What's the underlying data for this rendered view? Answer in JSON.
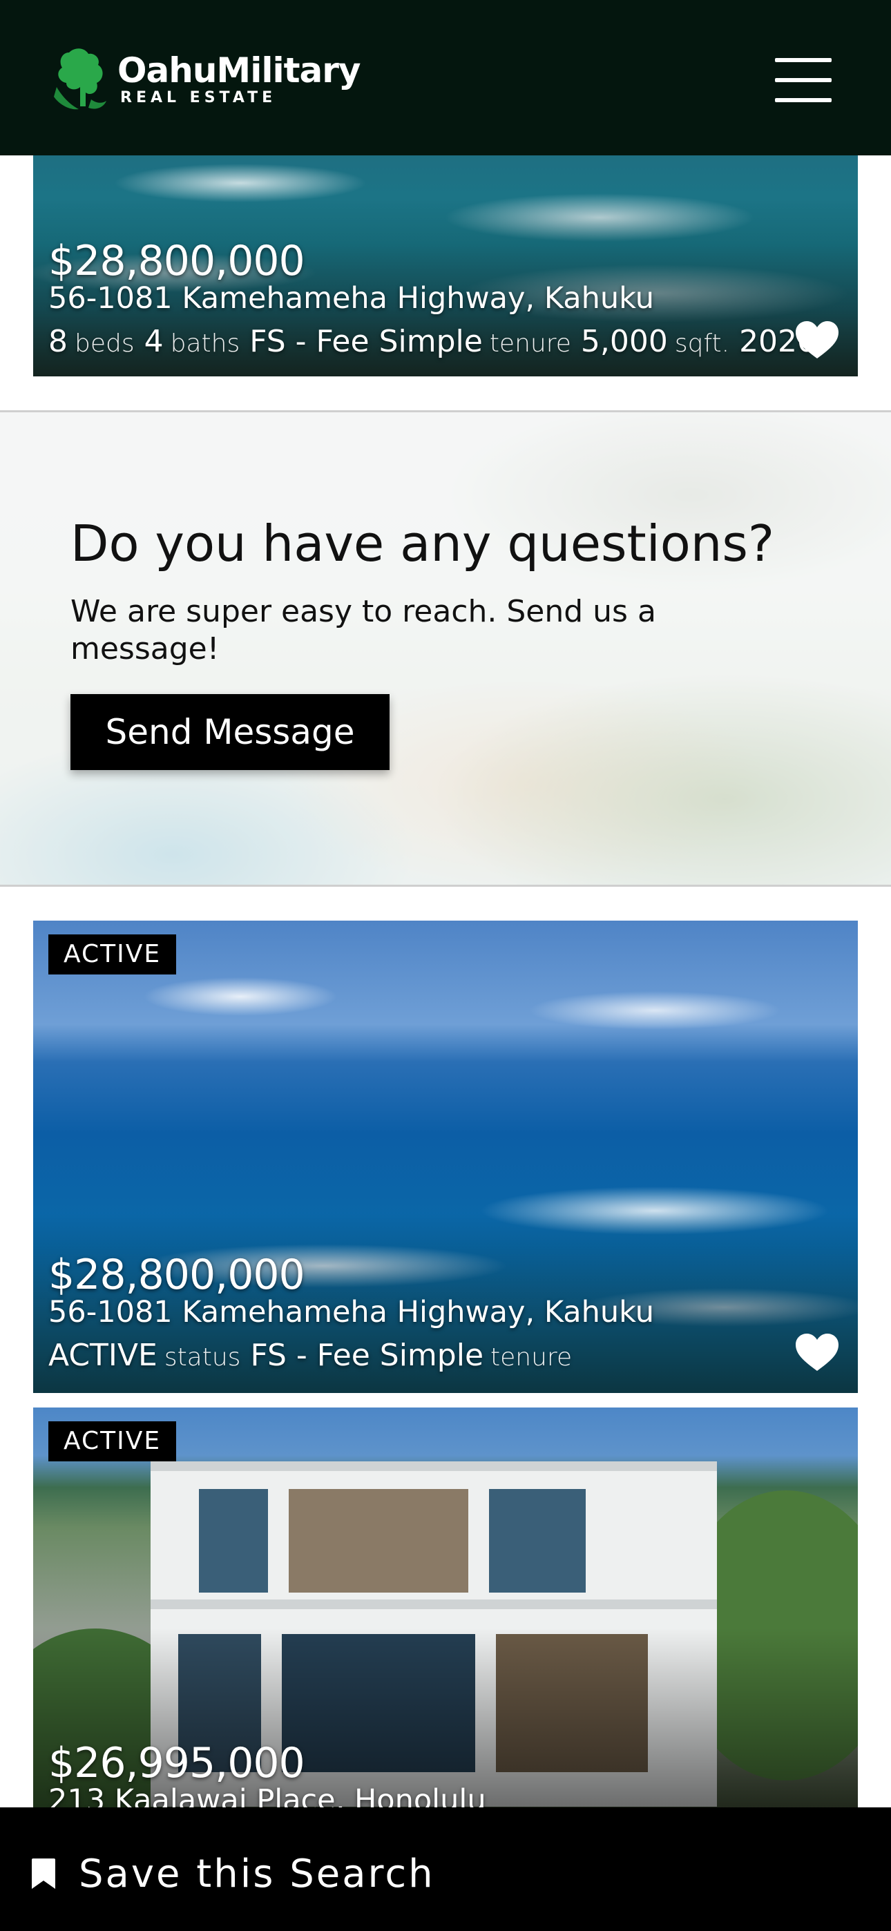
{
  "header": {
    "logo_name": "OahuMilitary",
    "logo_sub": "REAL ESTATE",
    "menu_icon": "hamburger-menu-icon"
  },
  "listings": [
    {
      "price": "$28,800,000",
      "address": "56-1081 Kamehameha Highway, Kahuku",
      "beds": "8",
      "beds_unit": "beds",
      "baths": "4",
      "baths_unit": "baths",
      "tenure": "FS - Fee Simple",
      "tenure_unit": "tenure",
      "sqft": "5,000",
      "sqft_unit": "sqft.",
      "year": "2020",
      "favorite_icon": "heart-icon"
    },
    {
      "badge": "ACTIVE",
      "price": "$28,800,000",
      "address": "56-1081 Kamehameha Highway, Kahuku",
      "status": "ACTIVE",
      "status_unit": "status",
      "tenure": "FS - Fee Simple",
      "tenure_unit": "tenure",
      "favorite_icon": "heart-icon"
    },
    {
      "badge": "ACTIVE",
      "price": "$26,995,000",
      "address": "213 Kaalawai Place, Honolulu"
    }
  ],
  "contact": {
    "title": "Do you have any questions?",
    "subtitle": "We are super easy to reach. Send us a message!",
    "button_label": "Send Message"
  },
  "save_search": {
    "label": "Save this Search",
    "icon": "bookmark-icon"
  }
}
